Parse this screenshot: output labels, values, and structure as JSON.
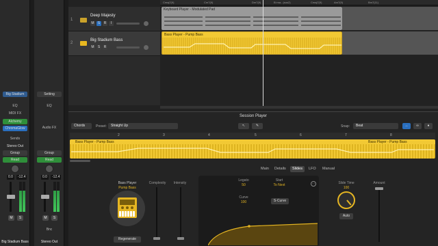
{
  "strips": [
    {
      "inst_slot": "Big Stadium",
      "setting": "",
      "eq": "EQ",
      "midi_fx": "MIDI FX",
      "plugins": [
        "Alchemy",
        "ChromaGlow"
      ],
      "sends": "Sends",
      "output": "Stereo Out",
      "group": "Group",
      "automation": "Read",
      "pan_val": "0.0",
      "level_val": "-12.4",
      "mute": "M",
      "solo": "S",
      "name": "Big Stadium Bass"
    },
    {
      "inst_slot": "Setting",
      "setting": "",
      "eq": "EQ",
      "midi_fx": "Audio FX",
      "plugins": [],
      "sends": "",
      "output": "",
      "group": "Group",
      "automation": "Read",
      "pan_val": "0.0",
      "level_val": "-12.4",
      "mute": "M",
      "solo": "S",
      "bnc": "Bnc",
      "name": "Stereo Out"
    }
  ],
  "tracks": [
    {
      "num": "1",
      "name": "Deep Majesty",
      "buttons": [
        "M",
        "S",
        "R",
        "I"
      ]
    },
    {
      "num": "2",
      "name": "Big Stadium Bass",
      "buttons": [
        "M",
        "S",
        "R"
      ]
    }
  ],
  "ruler": [
    "Cmaj7(9)",
    "Cm7(9)",
    "Dm7(9)",
    "B♭ma...(sus2)",
    "Cmaj7(9)",
    "Am7(9)",
    "Bm7(11)"
  ],
  "regions": {
    "keyboard": "Keyboard Player - Modulated Pad",
    "bass": "Bass Player - Pump Bass"
  },
  "session": {
    "title": "Session Player",
    "chords_label": "Chords",
    "preset_label": "Preset:",
    "preset_value": "Straight Up",
    "snap_label": "Snap:",
    "snap_value": "Beat",
    "ruler_marks": [
      "1",
      "2",
      "3",
      "4",
      "5",
      "6",
      "7",
      "8"
    ],
    "region_left": "Bass Player - Pump Bass",
    "region_right": "Bass Player - Pump Bass",
    "tabs": [
      "Main",
      "Details",
      "Slides",
      "LFO",
      "Manual"
    ],
    "active_tab": "Slides",
    "player_type": "Bass Player",
    "player_name": "Pump Bass",
    "complexity_label": "Complexity",
    "intensity_label": "Intensity",
    "legato_label": "Legato",
    "legato_value": "50",
    "start_label": "Start",
    "start_value": "To Next",
    "curve_label": "Curve",
    "curve_value": "100",
    "scurve_label": "S-Curve",
    "slide_time_label": "Slide Time",
    "slide_time_value": "100",
    "amount_label": "Amount",
    "auto_label": "Auto",
    "regenerate_label": "Regenerate"
  },
  "colors": {
    "accent": "#e6b622",
    "region_bass": "#f2c934",
    "region_keys": "#b8b8b8",
    "selection": "#3a7bd5"
  }
}
